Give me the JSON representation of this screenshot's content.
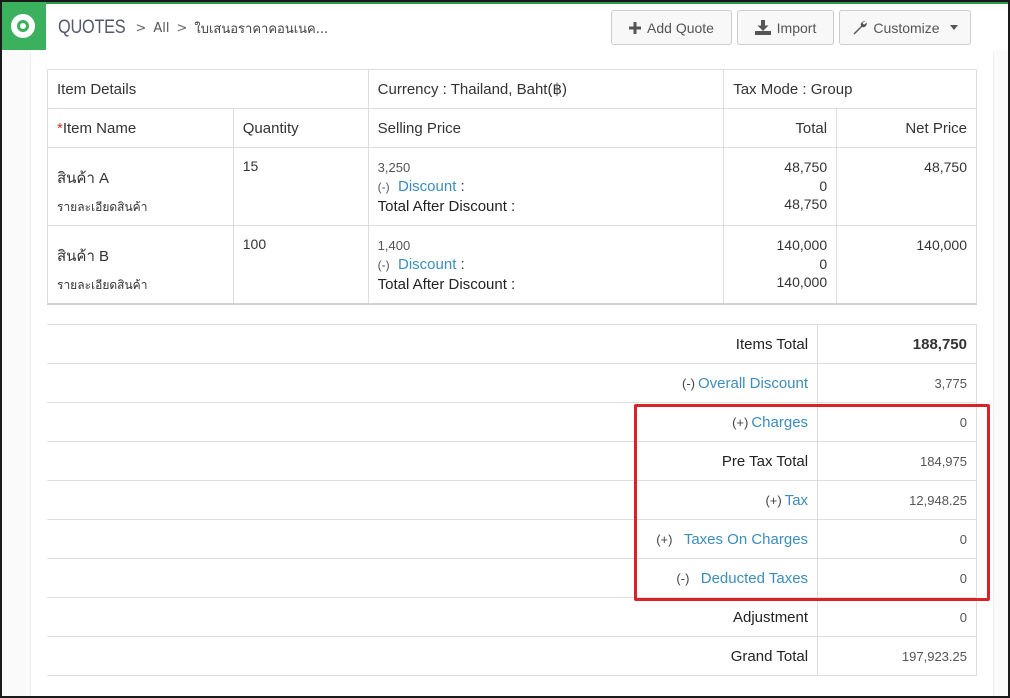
{
  "header": {
    "module": "QUOTES",
    "breadcrumb_all": "All",
    "record_name": "ใบเสนอราคาคอนเนค...",
    "buttons": {
      "add_quote": "Add Quote",
      "import": "Import",
      "customize": "Customize"
    }
  },
  "items_table": {
    "section_headers": {
      "item_details": "Item Details",
      "currency": "Currency : Thailand, Baht(฿)",
      "tax_mode": "Tax Mode : Group"
    },
    "columns": {
      "required_marker": "*",
      "item_name": "Item Name",
      "quantity": "Quantity",
      "selling_price": "Selling Price",
      "total": "Total",
      "net_price": "Net Price"
    },
    "discount_prefix": "(-)",
    "discount_label": "Discount",
    "discount_colon": ":",
    "total_after_discount": "Total After Discount :",
    "rows": [
      {
        "name": "สินค้า A",
        "description": "รายละเอียดสินค้า",
        "quantity": "15",
        "price": "3,250",
        "total": "48,750",
        "discount": "0",
        "after_discount": "48,750",
        "net_price": "48,750"
      },
      {
        "name": "สินค้า B",
        "description": "รายละเอียดสินค้า",
        "quantity": "100",
        "price": "1,400",
        "total": "140,000",
        "discount": "0",
        "after_discount": "140,000",
        "net_price": "140,000"
      }
    ]
  },
  "totals": {
    "items_total": {
      "label": "Items Total",
      "value": "188,750"
    },
    "overall_discount": {
      "prefix": "(-)",
      "label": "Overall Discount",
      "value": "3,775"
    },
    "charges": {
      "prefix": "(+)",
      "label": "Charges",
      "value": "0"
    },
    "pre_tax_total": {
      "label": "Pre Tax Total",
      "value": "184,975"
    },
    "tax": {
      "prefix": "(+)",
      "label": "Tax",
      "value": "12,948.25"
    },
    "taxes_on_charges": {
      "prefix": "(+)",
      "label": "Taxes On Charges",
      "value": "0"
    },
    "deducted_taxes": {
      "prefix": "(-)",
      "label": "Deducted Taxes",
      "value": "0"
    },
    "adjustment": {
      "label": "Adjustment",
      "value": "0"
    },
    "grand_total": {
      "label": "Grand Total",
      "value": "197,923.25"
    }
  },
  "colors": {
    "brand_green": "#3bb15d",
    "link_blue": "#3c8dbc",
    "annotation_red": "#d8232a"
  }
}
